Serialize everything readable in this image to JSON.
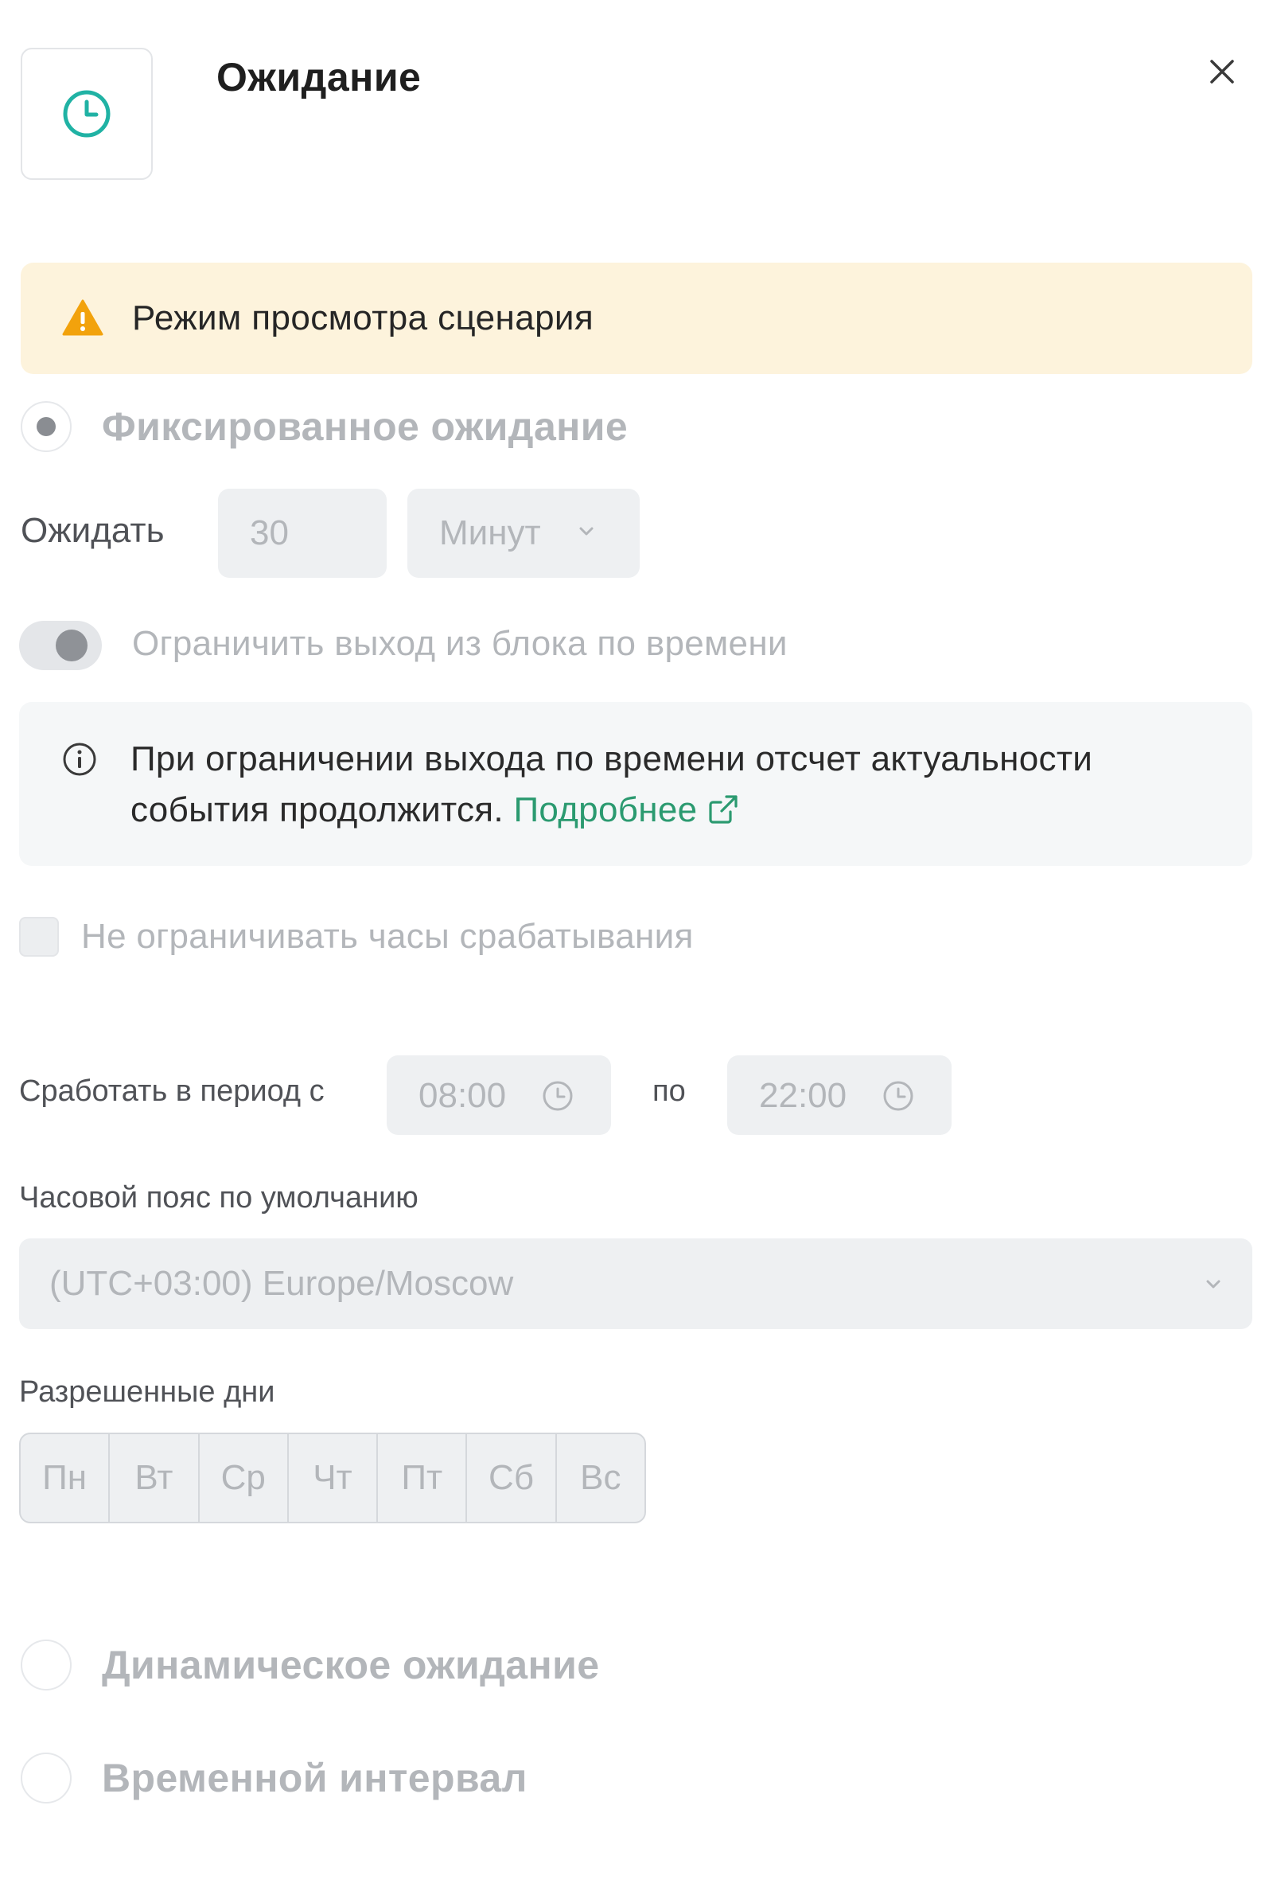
{
  "header": {
    "title": "Ожидание",
    "icon": "clock-icon",
    "close_icon": "close-icon"
  },
  "warning": {
    "text": "Режим просмотра сценария",
    "icon": "warning-triangle-icon"
  },
  "fixed_wait": {
    "label": "Фиксированное ожидание",
    "selected": true
  },
  "wait": {
    "label": "Ожидать",
    "value": "30",
    "unit": "Минут"
  },
  "limit_toggle": {
    "label": "Ограничить выход из блока по времени",
    "enabled": true
  },
  "info": {
    "text": "При ограничении выхода по времени отсчет актуальности события продолжится.",
    "link": "Подробнее"
  },
  "no_limit_hours": {
    "label": "Не ограничивать часы срабатывания",
    "checked": false
  },
  "period": {
    "label": "Сработать в период с",
    "from": "08:00",
    "to_label": "по",
    "to": "22:00"
  },
  "timezone": {
    "label": "Часовой пояс по умолчанию",
    "value": "(UTC+03:00) Europe/Moscow"
  },
  "days": {
    "label": "Разрешенные дни",
    "items": [
      "Пн",
      "Вт",
      "Ср",
      "Чт",
      "Пт",
      "Сб",
      "Вс"
    ]
  },
  "dynamic_wait": {
    "label": "Динамическое ожидание",
    "selected": false
  },
  "time_interval": {
    "label": "Временной интервал",
    "selected": false
  },
  "colors": {
    "accent": "#2b9a70",
    "warning_bg": "#fdf3dc",
    "warning_icon": "#f2a20c",
    "clock_icon": "#20b2a4"
  }
}
